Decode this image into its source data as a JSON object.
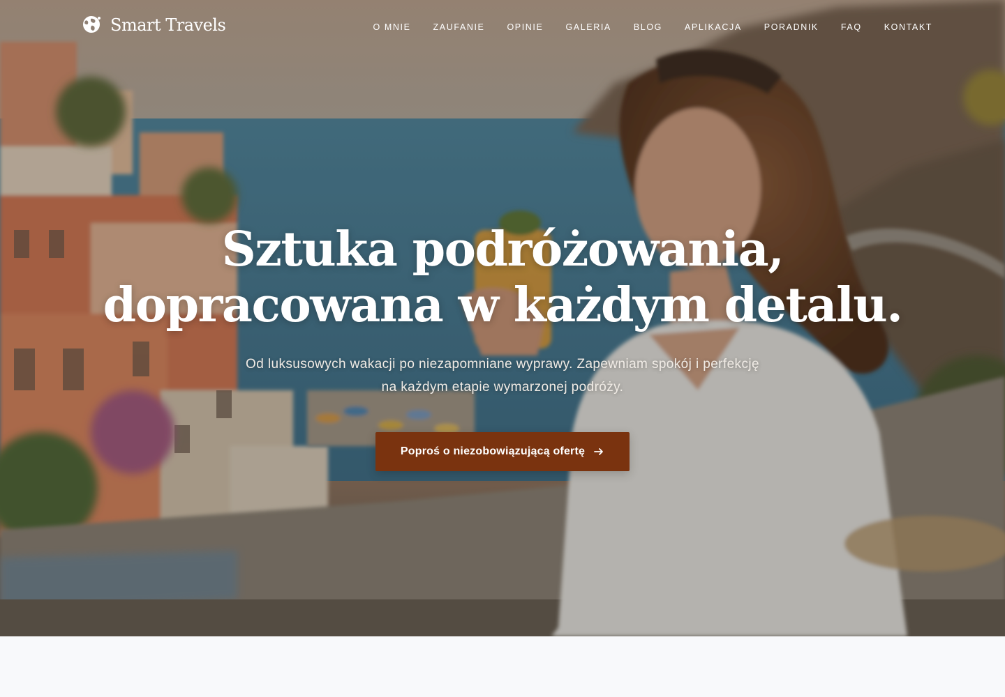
{
  "brand": {
    "name": "Smart Travels",
    "icon": "globe-icon"
  },
  "nav": {
    "items": [
      {
        "label": "O MNIE"
      },
      {
        "label": "ZAUFANIE"
      },
      {
        "label": "OPINIE"
      },
      {
        "label": "GALERIA"
      },
      {
        "label": "BLOG"
      },
      {
        "label": "APLIKACJA"
      },
      {
        "label": "PORADNIK"
      },
      {
        "label": "FAQ"
      },
      {
        "label": "KONTAKT"
      }
    ]
  },
  "hero": {
    "title_line1": "Sztuka podróżowania,",
    "title_line2": "dopracowana w każdym detalu.",
    "subtitle": "Od luksusowych wakacji po niezapomniane wyprawy. Zapewniam spokój i perfekcję na każdym etapie wymarzonej podróży.",
    "cta_label": "Poproś o niezobowiązującą ofertę",
    "cta_icon": "arrow-right-icon"
  },
  "colors": {
    "cta_background": "#7a330f",
    "page_background": "#f8f9fb",
    "text": "#ffffff"
  }
}
